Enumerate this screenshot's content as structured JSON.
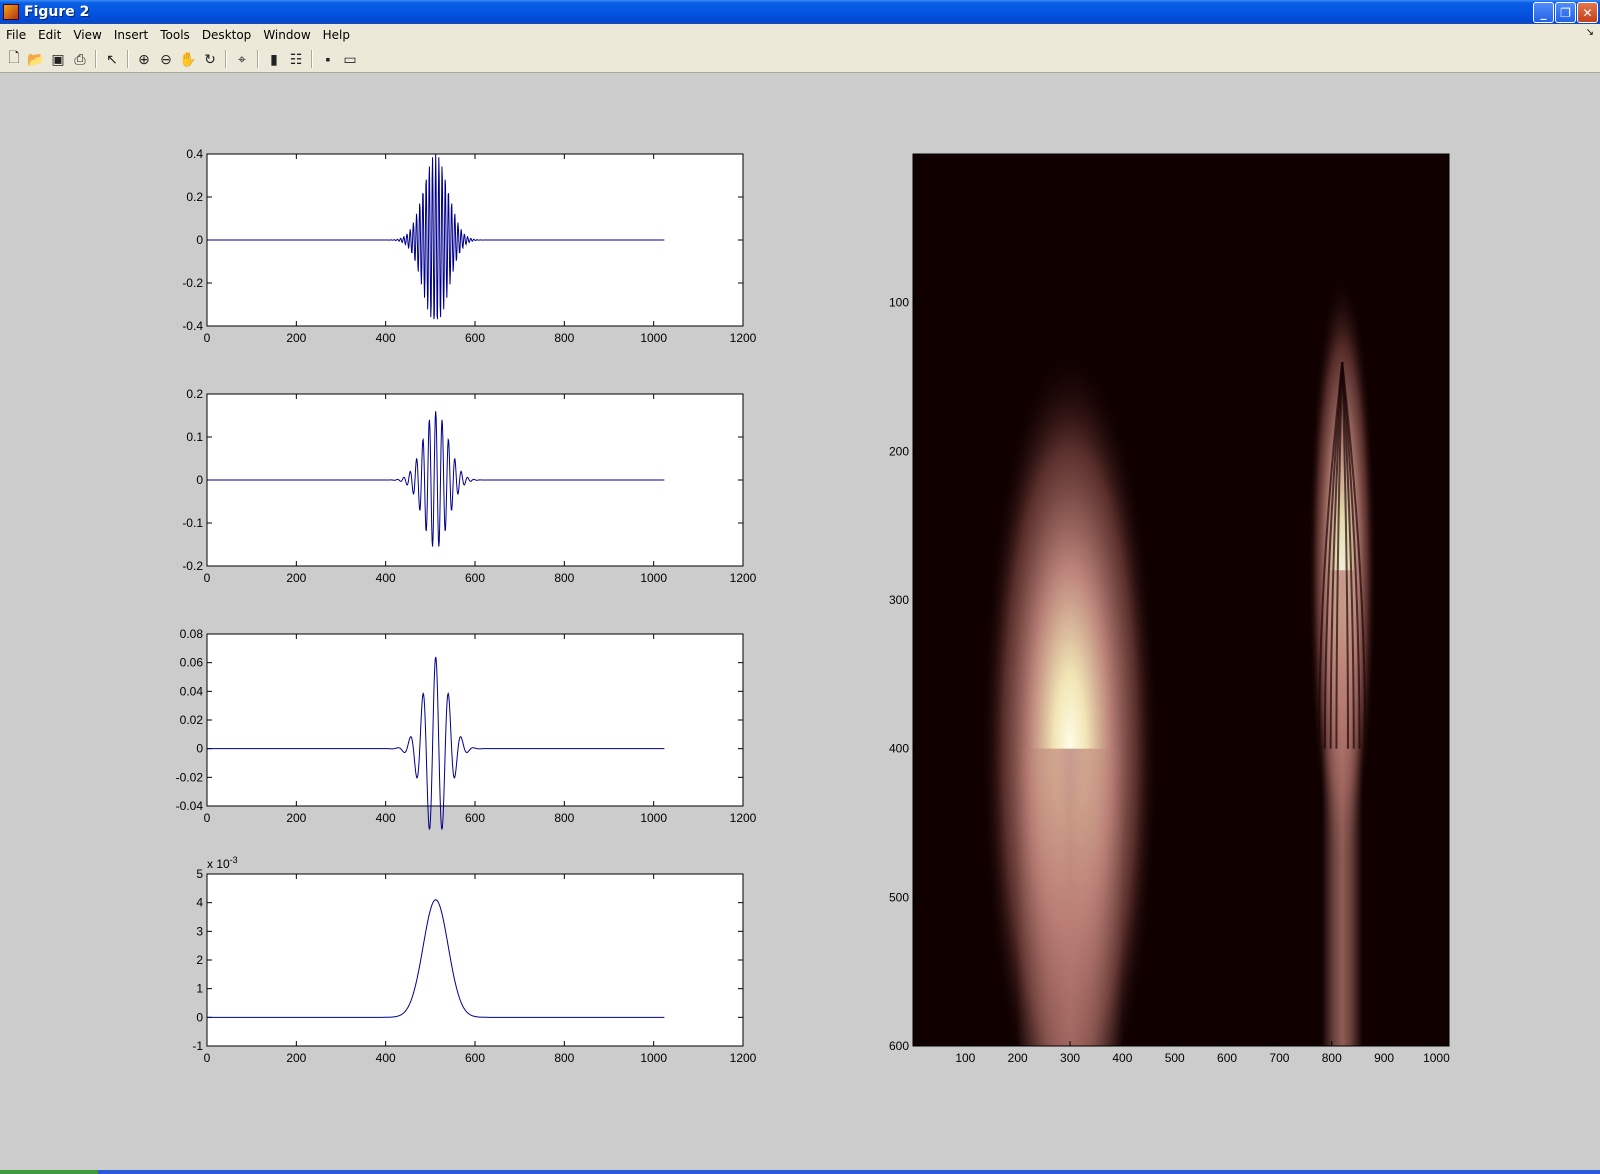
{
  "window": {
    "title": "Figure 2",
    "buttons": [
      "_",
      "❐",
      "✕"
    ]
  },
  "menus": [
    "File",
    "Edit",
    "View",
    "Insert",
    "Tools",
    "Desktop",
    "Window",
    "Help"
  ],
  "toolbar": {
    "icons": [
      "new-figure-icon",
      "open-file-icon",
      "save-icon",
      "print-icon",
      "edit-plot-arrow-icon",
      "zoom-in-icon",
      "zoom-out-icon",
      "pan-hand-icon",
      "rotate-3d-icon",
      "data-cursor-icon",
      "colorbar-icon",
      "legend-icon",
      "hide-plot-tools-icon",
      "show-plot-tools-icon"
    ]
  },
  "colors": {
    "line": "#00008b",
    "figure_bg": "#cccccc",
    "axes_bg": "#ffffff"
  },
  "chart_data": [
    {
      "type": "line",
      "series_desc": "modulated oscillation, envelope centered at 512, high frequency",
      "xlim": [
        0,
        1200
      ],
      "ylim": [
        -0.4,
        0.4
      ],
      "xticks": [
        "0",
        "200",
        "400",
        "600",
        "800",
        "1000",
        "1200"
      ],
      "yticks": [
        "0.4",
        "0.2",
        "0",
        "-0.2",
        "-0.4"
      ],
      "x_range": [
        1,
        1024
      ],
      "center": 512,
      "amplitude": 0.4,
      "sigma": 28,
      "cycles_per_sample": 0.14
    },
    {
      "type": "line",
      "xlim": [
        0,
        1200
      ],
      "ylim": [
        -0.2,
        0.2
      ],
      "xticks": [
        "0",
        "200",
        "400",
        "600",
        "800",
        "1000",
        "1200"
      ],
      "yticks": [
        "0.2",
        "0.1",
        "0",
        "-0.1",
        "-0.2"
      ],
      "x_range": [
        1,
        1024
      ],
      "center": 512,
      "amplitude": 0.16,
      "sigma": 28,
      "cycles_per_sample": 0.07
    },
    {
      "type": "line",
      "xlim": [
        0,
        1200
      ],
      "ylim": [
        -0.04,
        0.08
      ],
      "xticks": [
        "0",
        "200",
        "400",
        "600",
        "800",
        "1000",
        "1200"
      ],
      "yticks": [
        "0.08",
        "0.06",
        "0.04",
        "0.02",
        "0",
        "-0.02",
        "-0.04"
      ],
      "x_range": [
        1,
        1024
      ],
      "center": 512,
      "amplitude": 0.064,
      "sigma": 28,
      "cycles_per_sample": 0.035
    },
    {
      "type": "line",
      "xlim": [
        0,
        1200
      ],
      "ylim": [
        -1,
        5
      ],
      "xticks": [
        "0",
        "200",
        "400",
        "600",
        "800",
        "1000",
        "1200"
      ],
      "yticks": [
        "5",
        "4",
        "3",
        "2",
        "1",
        "0",
        "-1"
      ],
      "exponent_label": "x 10",
      "exponent_power": "-3",
      "x_range": [
        1,
        1024
      ],
      "center": 512,
      "amplitude": 4.1,
      "sigma": 28,
      "cycles_per_sample": 0
    },
    {
      "type": "heatmap",
      "colormap": "pink",
      "xlim": [
        0,
        1024
      ],
      "ylim": [
        0,
        600
      ],
      "xticks": [
        "100",
        "200",
        "300",
        "400",
        "500",
        "600",
        "700",
        "800",
        "900",
        "1000"
      ],
      "yticks": [
        "100",
        "200",
        "300",
        "400",
        "500",
        "600"
      ],
      "blobs": [
        {
          "cx": 300,
          "cy": 400,
          "rx": 170,
          "ry": 270,
          "peak": 1.0
        },
        {
          "cx": 820,
          "cy": 280,
          "rx": 65,
          "ry": 200,
          "peak": 0.95
        }
      ]
    }
  ]
}
